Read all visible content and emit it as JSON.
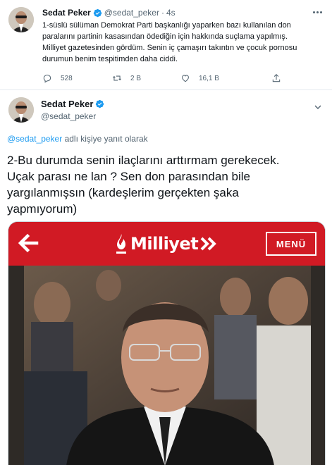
{
  "tweet1": {
    "author_name": "Sedat Peker",
    "handle": "@sedat_peker",
    "separator": "·",
    "time": "4s",
    "text_lines": [
      "1-süslü sülüman Demokrat Parti başkanlığı yaparken bazı kullanılan don",
      "paralarını partinin kasasından ödediğin için hakkında suçlama yapılmış.",
      "Milliyet gazetesinden gördüm. Senin iç çamaşırı takıntın ve çocuk pornosu",
      "durumun benim tespitimden daha ciddi."
    ],
    "reply_count": "528",
    "retweet_count": "2 B",
    "like_count": "16,1 B"
  },
  "tweet2": {
    "author_name": "Sedat Peker",
    "handle": "@sedat_peker",
    "reply_mention": "@sedat_peker",
    "reply_suffix": " adlı kişiye yanıt olarak",
    "text_lines": [
      "2-Bu durumda senin ilaçlarını arttırmam gerekecek.",
      "Uçak parası ne lan ? Sen don parasından  bile",
      "yargılanmışsın (kardeşlerim gerçekten şaka",
      "yapmıyorum)"
    ]
  },
  "media": {
    "logo_text": "Milliyet",
    "menu_label": "MENÜ"
  },
  "colors": {
    "brand_red": "#d11a24",
    "verified_blue": "#1d9bf0",
    "secondary_text": "#536471"
  },
  "icons": [
    "verified-badge-icon",
    "more-icon",
    "reply-icon",
    "retweet-icon",
    "like-icon",
    "share-icon",
    "follow-arrow-icon",
    "back-arrow-icon",
    "flame-icon",
    "chevrons-icon"
  ]
}
